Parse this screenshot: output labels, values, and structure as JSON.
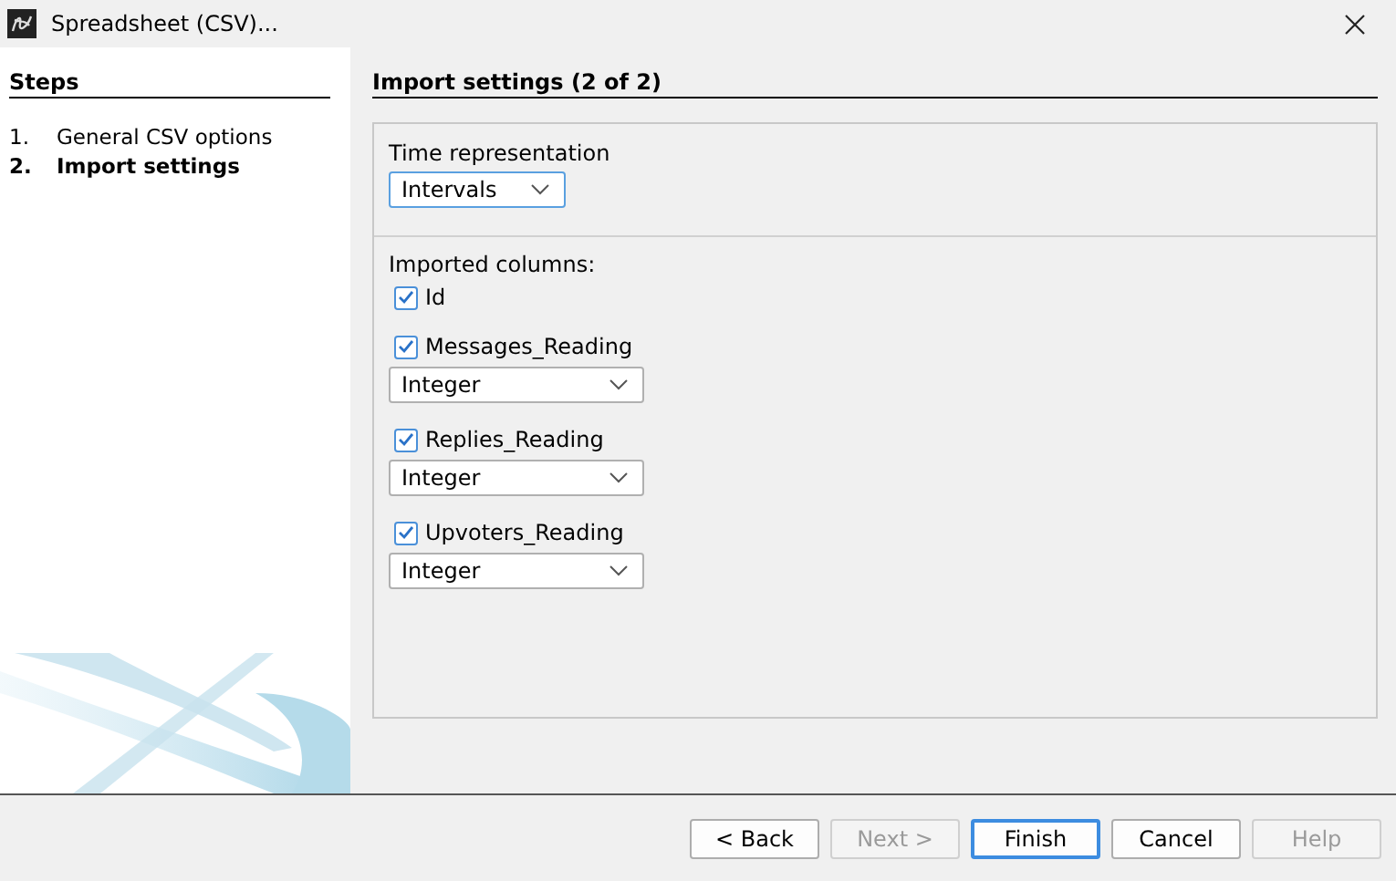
{
  "window": {
    "title": "Spreadsheet (CSV)..."
  },
  "steps": {
    "title": "Steps",
    "items": [
      {
        "number": "1.",
        "label": "General CSV options",
        "selected": false
      },
      {
        "number": "2.",
        "label": "Import settings",
        "selected": true
      }
    ]
  },
  "page": {
    "title": "Import settings (2 of 2)",
    "time_representation": {
      "label": "Time representation",
      "value": "Intervals"
    },
    "imported_columns_label": "Imported columns:",
    "columns": [
      {
        "name": "Id",
        "checked": true
      },
      {
        "name": "Messages_Reading",
        "checked": true,
        "type": "Integer"
      },
      {
        "name": "Replies_Reading",
        "checked": true,
        "type": "Integer"
      },
      {
        "name": "Upvoters_Reading",
        "checked": true,
        "type": "Integer"
      }
    ]
  },
  "buttons": [
    {
      "label": "< Back",
      "disabled": false,
      "focused": false
    },
    {
      "label": "Next >",
      "disabled": true,
      "focused": false
    },
    {
      "label": "Finish",
      "disabled": false,
      "focused": true
    },
    {
      "label": "Cancel",
      "disabled": false,
      "focused": false
    },
    {
      "label": "Help",
      "disabled": true,
      "focused": false
    }
  ]
}
